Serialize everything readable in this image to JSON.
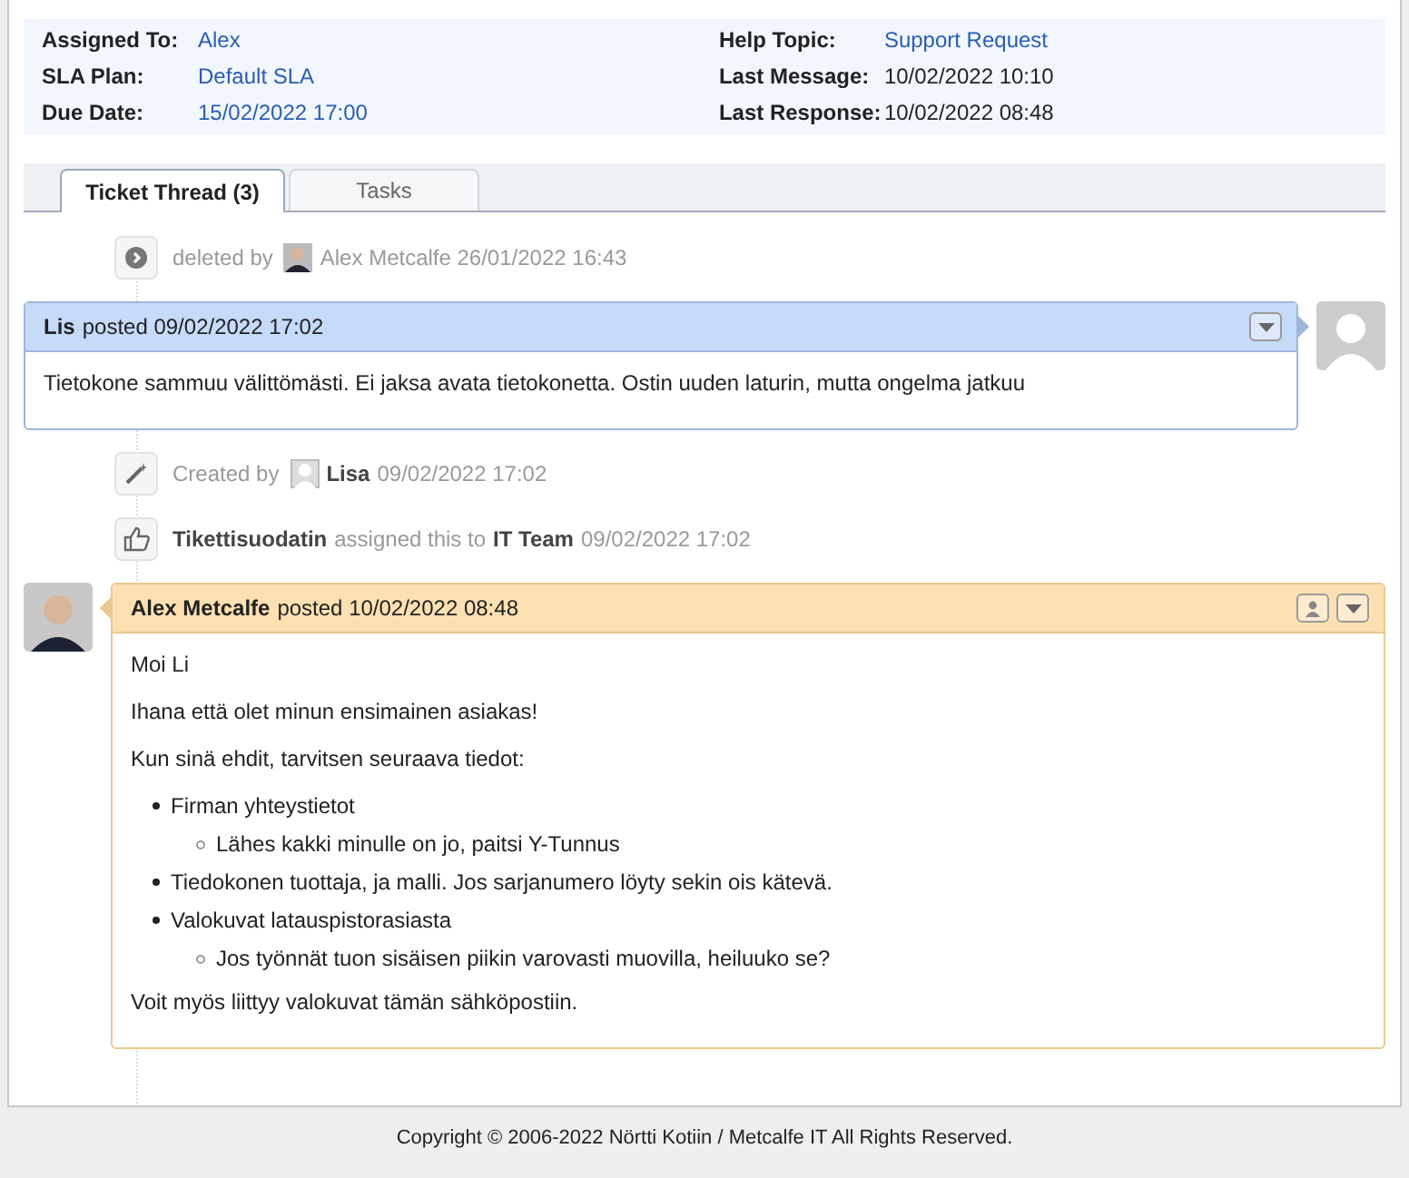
{
  "info": {
    "left": [
      {
        "label": "Assigned To:",
        "value": "Alex"
      },
      {
        "label": "SLA Plan:",
        "value": "Default SLA"
      },
      {
        "label": "Due Date:",
        "value": "15/02/2022 17:00"
      }
    ],
    "right": [
      {
        "label": "Help Topic:",
        "value": "Support Request",
        "link": true
      },
      {
        "label": "Last Message:",
        "value": "10/02/2022 10:10",
        "link": false
      },
      {
        "label": "Last Response:",
        "value": "10/02/2022 08:48",
        "link": false
      }
    ]
  },
  "tabs": [
    {
      "label": "Ticket Thread (3)",
      "selected": true
    },
    {
      "label": "Tasks",
      "selected": false
    }
  ],
  "thread": [
    {
      "kind": "deleted",
      "parts": [
        {
          "text": "deleted by",
          "bold": false
        },
        {
          "text": "Alex Metcalfe 26/01/2022 16:43",
          "bold": false
        }
      ]
    },
    {
      "kind": "customer-message",
      "author": "Lis",
      "posted": "posted 09/02/2022 17:02",
      "body": [
        {
          "kind": "p",
          "text": "Tietokone sammuu välittömästi. Ei jaksa avata tietokonetta. Ostin uuden laturin, mutta ongelma jatkuu"
        }
      ]
    },
    {
      "kind": "created",
      "parts": [
        {
          "text": "Created by",
          "bold": false
        },
        {
          "text": "Lisa",
          "bold": true
        },
        {
          "text": "09/02/2022 17:02",
          "bold": false
        }
      ]
    },
    {
      "kind": "assigned",
      "parts": [
        {
          "text": "Tikettisuodatin",
          "bold": true
        },
        {
          "text": "assigned this to",
          "bold": false
        },
        {
          "text": "IT Team",
          "bold": true
        },
        {
          "text": "09/02/2022 17:02",
          "bold": false
        }
      ]
    },
    {
      "kind": "agent-message",
      "author": "Alex Metcalfe",
      "posted": "posted 10/02/2022 08:48",
      "body": [
        {
          "kind": "p",
          "text": "Moi Li"
        },
        {
          "kind": "p",
          "text": "Ihana että olet minun ensimainen asiakas!"
        },
        {
          "kind": "p",
          "text": "Kun sinä ehdit, tarvitsen seuraava tiedot:"
        },
        {
          "kind": "list",
          "items": [
            {
              "text": "Firman yhteystietot",
              "children": [
                {
                  "text": "Lähes kakki minulle on jo, paitsi Y-Tunnus"
                }
              ]
            },
            {
              "text": "Tiedokonen tuottaja, ja malli. Jos sarjanumero löyty sekin ois kätevä."
            },
            {
              "text": "Valokuvat latauspistorasiasta",
              "children": [
                {
                  "text": "Jos työnnät tuon sisäisen piikin varovasti muovilla, heiluuko se?"
                }
              ]
            }
          ]
        },
        {
          "kind": "p",
          "text": "Voit myös liittyy valokuvat tämän sähköpostiin."
        }
      ]
    }
  ],
  "footer": "Copyright © 2006-2022 Nörtti Kotiin / Metcalfe IT All Rights Reserved."
}
